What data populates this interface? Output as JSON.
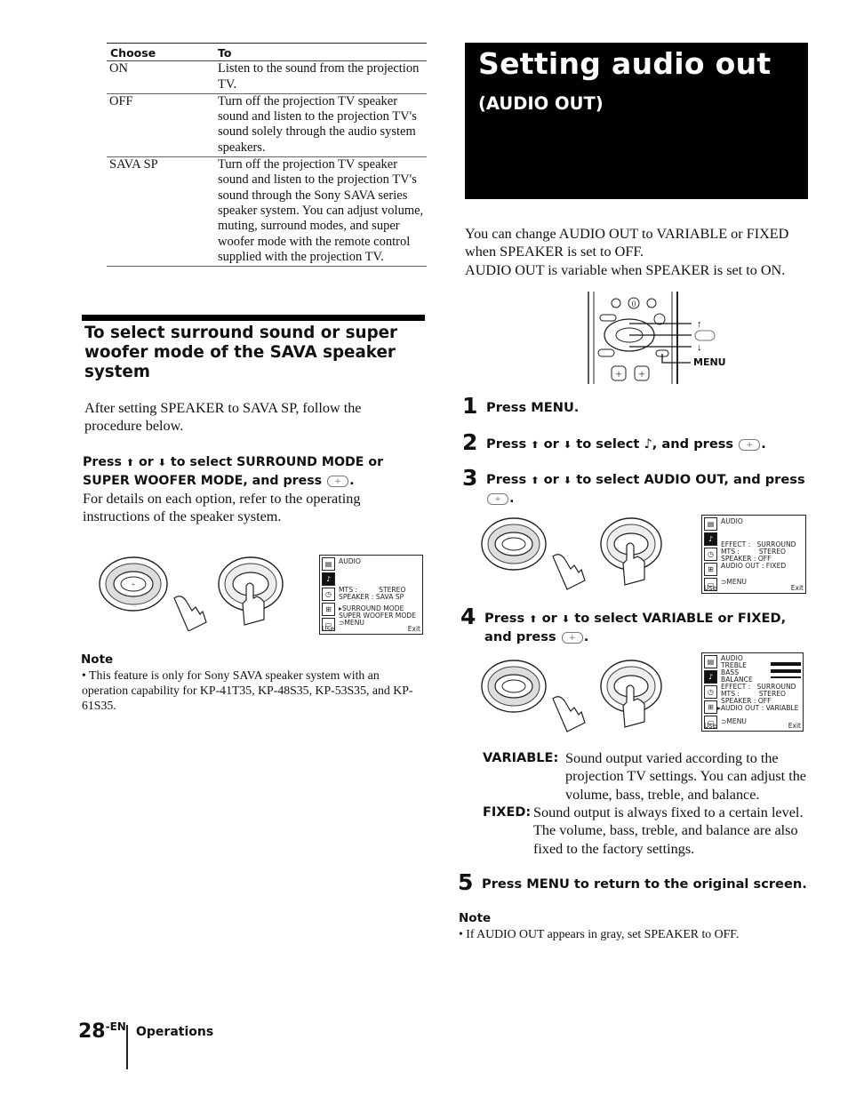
{
  "table": {
    "headers": [
      "Choose",
      "To"
    ],
    "rows": [
      {
        "choose": "ON",
        "to": "Listen to the sound from the projection TV."
      },
      {
        "choose": "OFF",
        "to": "Turn off the projection TV speaker sound and listen to the projection TV's sound solely through the audio system speakers."
      },
      {
        "choose": "SAVA SP",
        "to": "Turn off the projection TV speaker sound and listen to the projection TV's sound through the Sony SAVA series speaker system.  You can adjust volume, muting, surround modes, and super woofer mode with the remote control supplied with the projection TV."
      }
    ]
  },
  "section": {
    "heading": "To select surround sound or super woofer mode of the SAVA speaker system",
    "intro": "After setting SPEAKER to SAVA SP, follow the procedure below.",
    "instruction_bold_1": "Press",
    "instruction_bold_2": "or",
    "instruction_bold_3": "to select SURROUND MODE or SUPER WOOFER MODE, and press",
    "instruction_detail": "For details on each option, refer to the operating instructions of the speaker system.",
    "osd": {
      "title": "AUDIO",
      "rows": [
        "MTS :          STEREO",
        "SPEAKER : SAVA SP"
      ],
      "selected_rows": [
        "SURROUND MODE",
        "SUPER WOOFER MODE"
      ],
      "menu_label": "MENU",
      "use_label": "Use",
      "exit_label": "Exit"
    },
    "note_title": "Note",
    "note_text": "This feature is only for Sony SAVA speaker system with an operation capability for KP-41T35, KP-48S35, KP-53S35, and KP-61S35."
  },
  "title": {
    "main": "Setting audio out",
    "sub": "(AUDIO OUT)"
  },
  "intro": {
    "line1": "You can change AUDIO OUT to VARIABLE or FIXED when SPEAKER is set to OFF.",
    "line2": "AUDIO OUT is variable when SPEAKER is set to ON."
  },
  "remote": {
    "up_label": "↑",
    "down_label": "↓",
    "menu_label": "MENU",
    "zero_label": "0"
  },
  "steps": [
    {
      "num": "1",
      "text": "Press MENU."
    },
    {
      "num": "2",
      "text_a": "Press",
      "text_b": "or",
      "text_c": "to select ♪, and press"
    },
    {
      "num": "3",
      "text_a": "Press",
      "text_b": "or",
      "text_c": "to select AUDIO OUT, and press"
    },
    {
      "num": "4",
      "text_a": "Press",
      "text_b": "or",
      "text_c": "to select VARIABLE or FIXED,",
      "text_d": "and press"
    },
    {
      "num": "5",
      "text": "Press MENU to return to the original screen."
    }
  ],
  "osd_step3": {
    "title": "AUDIO",
    "rows": [
      "EFFECT :   SURROUND",
      "MTS :         STEREO",
      "SPEAKER : OFF",
      "AUDIO OUT : FIXED"
    ],
    "menu_label": "MENU",
    "use_label": "Use",
    "exit_label": "Exit"
  },
  "osd_step4": {
    "title": "AUDIO",
    "sliders": [
      {
        "label": "TREBLE",
        "level": 0.5
      },
      {
        "label": "BASS",
        "level": 0.5
      },
      {
        "label": "BALANCE",
        "level": 0.5
      }
    ],
    "rows": [
      "EFFECT :   SURROUND",
      "MTS :         STEREO",
      "SPEAKER : OFF"
    ],
    "selected_row": "AUDIO OUT : VARIABLE",
    "menu_label": "MENU",
    "use_label": "Use",
    "exit_label": "Exit"
  },
  "definitions": [
    {
      "term": "VARIABLE:",
      "desc": "Sound output varied according to the projection TV settings. You can adjust the volume, bass, treble, and balance."
    },
    {
      "term": "FIXED:",
      "desc": "Sound output is always fixed to a certain level. The volume, bass, treble, and balance are also fixed to the factory settings."
    }
  ],
  "note2": {
    "title": "Note",
    "text": "If AUDIO OUT appears in gray, set SPEAKER to OFF."
  },
  "footer": {
    "page": "28",
    "suffix": "-EN",
    "section": "Operations"
  }
}
